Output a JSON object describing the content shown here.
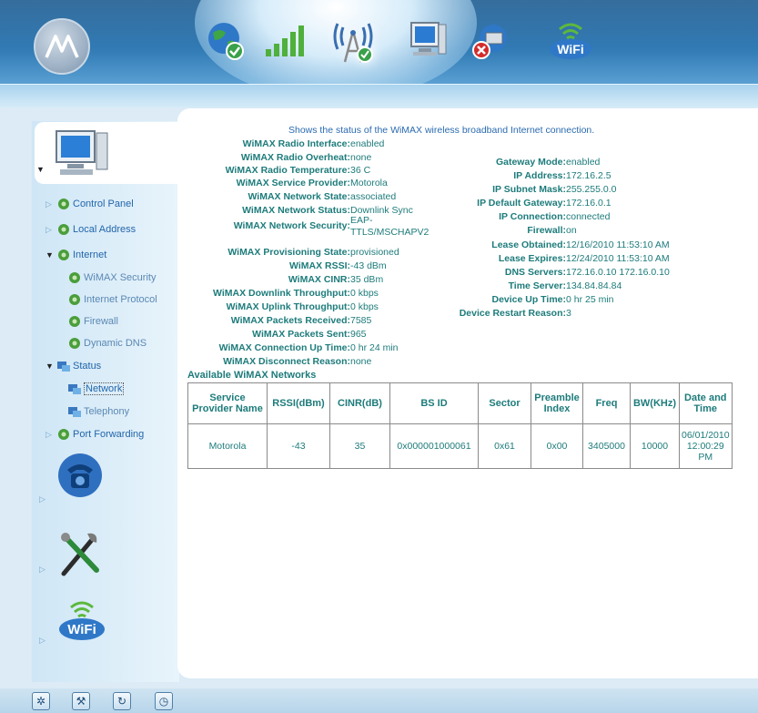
{
  "description": "Shows the status of the WiMAX wireless broadband Internet connection.",
  "wimax_status": [
    {
      "label": "WiMAX Radio Interface:",
      "value": "enabled"
    },
    {
      "label": "WiMAX Radio Overheat:",
      "value": "none"
    },
    {
      "label": "WiMAX Radio Temperature:",
      "value": "36 C"
    },
    {
      "label": "WiMAX Service Provider:",
      "value": "Motorola"
    },
    {
      "label": "WiMAX Network State:",
      "value": "associated"
    },
    {
      "label": "WiMAX Network Status:",
      "value": "Downlink Sync"
    },
    {
      "label": "WiMAX Network Security:",
      "value": "EAP-TTLS/MSCHAPV2"
    },
    {
      "label": "WiMAX Provisioning State:",
      "value": " provisioned"
    },
    {
      "label": "WiMAX RSSI:",
      "value": "-43 dBm"
    },
    {
      "label": "WiMAX CINR:",
      "value": "35 dBm"
    },
    {
      "label": "WiMAX Downlink Throughput:",
      "value": "0 kbps"
    },
    {
      "label": "WiMAX Uplink Throughput:",
      "value": "0 kbps"
    },
    {
      "label": "WiMAX Packets Received:",
      "value": "7585"
    },
    {
      "label": "WiMAX Packets Sent:",
      "value": "965"
    },
    {
      "label": "WiMAX Connection Up Time:",
      "value": "0 hr 24 min"
    },
    {
      "label": "WiMAX Disconnect Reason:",
      "value": "none"
    }
  ],
  "gateway_status": [
    {
      "label": "Gateway Mode:",
      "value": "enabled"
    },
    {
      "label": "IP Address:",
      "value": "172.16.2.5"
    },
    {
      "label": "IP Subnet Mask:",
      "value": "255.255.0.0"
    },
    {
      "label": "IP Default Gateway:",
      "value": "172.16.0.1"
    },
    {
      "label": "IP Connection:",
      "value": "connected"
    },
    {
      "label": "Firewall:",
      "value": "on"
    },
    {
      "label": "Lease Obtained:",
      "value": "12/16/2010 11:53:10 AM"
    },
    {
      "label": "Lease Expires:",
      "value": "12/24/2010 11:53:10 AM"
    },
    {
      "label": "DNS Servers:",
      "value": "172.16.0.10 172.16.0.10"
    },
    {
      "label": "Time Server:",
      "value": "134.84.84.84"
    },
    {
      "label": "Device Up Time:",
      "value": "0 hr 25 min"
    },
    {
      "label": "Device Restart Reason:",
      "value": "3"
    }
  ],
  "networks": {
    "title": "Available WiMAX Networks",
    "headers": [
      "Service Provider Name",
      "RSSI(dBm)",
      "CINR(dB)",
      "BS ID",
      "Sector",
      "Preamble Index",
      "Freq",
      "BW(KHz)",
      "Date and Time"
    ],
    "rows": [
      [
        "Motorola",
        "-43",
        "35",
        "0x000001000061",
        "0x61",
        "0x00",
        "3405000",
        "10000",
        "06/01/2010 12:00:29 PM"
      ]
    ]
  },
  "nav": {
    "control_panel": "Control Panel",
    "local_address": "Local Address",
    "internet": "Internet",
    "wimax_security": "WiMAX Security",
    "internet_protocol": "Internet Protocol",
    "firewall": "Firewall",
    "dynamic_dns": "Dynamic DNS",
    "status": "Status",
    "network": "Network",
    "telephony": "Telephony",
    "port_forwarding": "Port Forwarding"
  },
  "icons": {
    "logo": "motorola-logo",
    "top": [
      "internet-globe-icon",
      "signal-bars-icon",
      "wimax-tower-icon",
      "computer-icon",
      "network-error-icon",
      "wifi-icon"
    ],
    "footer": [
      "snowflake-icon",
      "tool-icon",
      "refresh-icon",
      "schedule-icon"
    ]
  },
  "colors": {
    "accent": "#2e78b3",
    "value_text": "#1e7b7b",
    "link": "#2266aa"
  }
}
